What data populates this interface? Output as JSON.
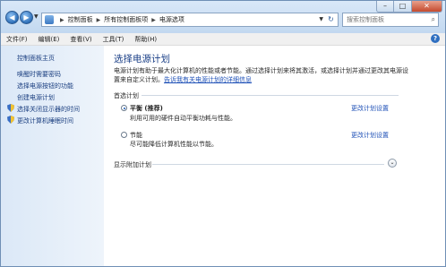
{
  "address": {
    "crumbs": [
      "控制面板",
      "所有控制面板项",
      "电源选项"
    ]
  },
  "search": {
    "placeholder": "搜索控制面板"
  },
  "menu": {
    "items": [
      "文件(F)",
      "编辑(E)",
      "查看(V)",
      "工具(T)",
      "帮助(H)"
    ]
  },
  "sidebar": {
    "items": [
      {
        "label": "控制面板主页"
      },
      {
        "label": "唤醒时需要密码"
      },
      {
        "label": "选择电源按钮的功能"
      },
      {
        "label": "创建电源计划"
      },
      {
        "label": "选择关闭显示器的时间"
      },
      {
        "label": "更改计算机睡眠时间"
      }
    ]
  },
  "main": {
    "title": "选择电源计划",
    "description": "电源计划有助于最大化计算机的性能或者节能。通过选择计划来将其激活，或选择计划并通过更改其电源设置来自定义计划。",
    "description_link": "告诉我有关电源计划的详细信息",
    "group_label": "首选计划",
    "plans": [
      {
        "name": "平衡 (推荐)",
        "desc": "利用可用的硬件自动平衡功耗与性能。",
        "link": "更改计划设置",
        "selected": true
      },
      {
        "name": "节能",
        "desc": "尽可能降低计算机性能以节能。",
        "link": "更改计划设置",
        "selected": false
      }
    ],
    "extra_label": "显示附加计划"
  },
  "colors": {
    "link": "#1f51b7",
    "title": "#1a3f87",
    "sidebar_bg": "#dbe8f7"
  }
}
